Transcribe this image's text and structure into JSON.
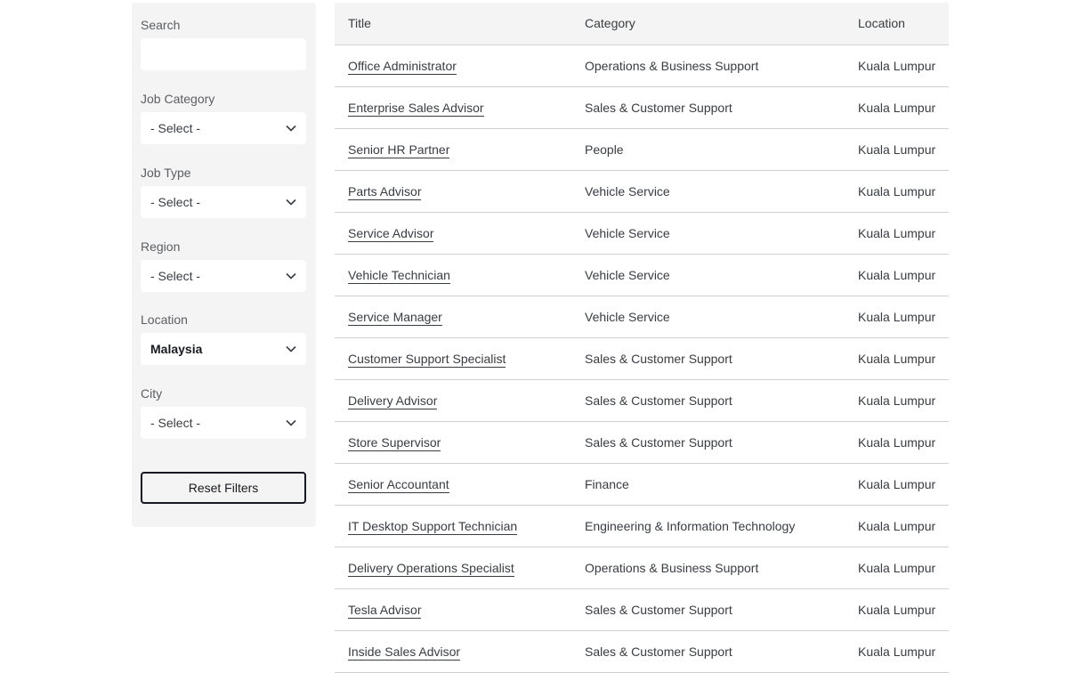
{
  "filters": {
    "search": {
      "label": "Search",
      "value": "",
      "placeholder": ""
    },
    "job_category": {
      "label": "Job Category",
      "value": "- Select -"
    },
    "job_type": {
      "label": "Job Type",
      "value": "- Select -"
    },
    "region": {
      "label": "Region",
      "value": "- Select -"
    },
    "location": {
      "label": "Location",
      "value": "Malaysia"
    },
    "city": {
      "label": "City",
      "value": "- Select -"
    },
    "reset_label": "Reset Filters"
  },
  "table": {
    "headers": {
      "title": "Title",
      "category": "Category",
      "location": "Location"
    },
    "rows": [
      {
        "title": "Office Administrator",
        "category": "Operations & Business Support",
        "location": "Kuala Lumpur"
      },
      {
        "title": "Enterprise Sales Advisor",
        "category": "Sales & Customer Support",
        "location": "Kuala Lumpur"
      },
      {
        "title": "Senior HR Partner",
        "category": "People",
        "location": "Kuala Lumpur"
      },
      {
        "title": "Parts Advisor",
        "category": "Vehicle Service",
        "location": "Kuala Lumpur"
      },
      {
        "title": "Service Advisor",
        "category": "Vehicle Service",
        "location": "Kuala Lumpur"
      },
      {
        "title": "Vehicle Technician",
        "category": "Vehicle Service",
        "location": "Kuala Lumpur"
      },
      {
        "title": "Service Manager",
        "category": "Vehicle Service",
        "location": "Kuala Lumpur"
      },
      {
        "title": "Customer Support Specialist",
        "category": "Sales & Customer Support",
        "location": "Kuala Lumpur"
      },
      {
        "title": "Delivery Advisor",
        "category": "Sales & Customer Support",
        "location": "Kuala Lumpur"
      },
      {
        "title": "Store Supervisor",
        "category": "Sales & Customer Support",
        "location": "Kuala Lumpur"
      },
      {
        "title": "Senior Accountant",
        "category": "Finance",
        "location": "Kuala Lumpur"
      },
      {
        "title": "IT Desktop Support Technician",
        "category": "Engineering & Information Technology",
        "location": "Kuala Lumpur"
      },
      {
        "title": "Delivery Operations Specialist",
        "category": "Operations & Business Support",
        "location": "Kuala Lumpur"
      },
      {
        "title": "Tesla Advisor",
        "category": "Sales & Customer Support",
        "location": "Kuala Lumpur"
      },
      {
        "title": "Inside Sales Advisor",
        "category": "Sales & Customer Support",
        "location": "Kuala Lumpur"
      }
    ]
  }
}
